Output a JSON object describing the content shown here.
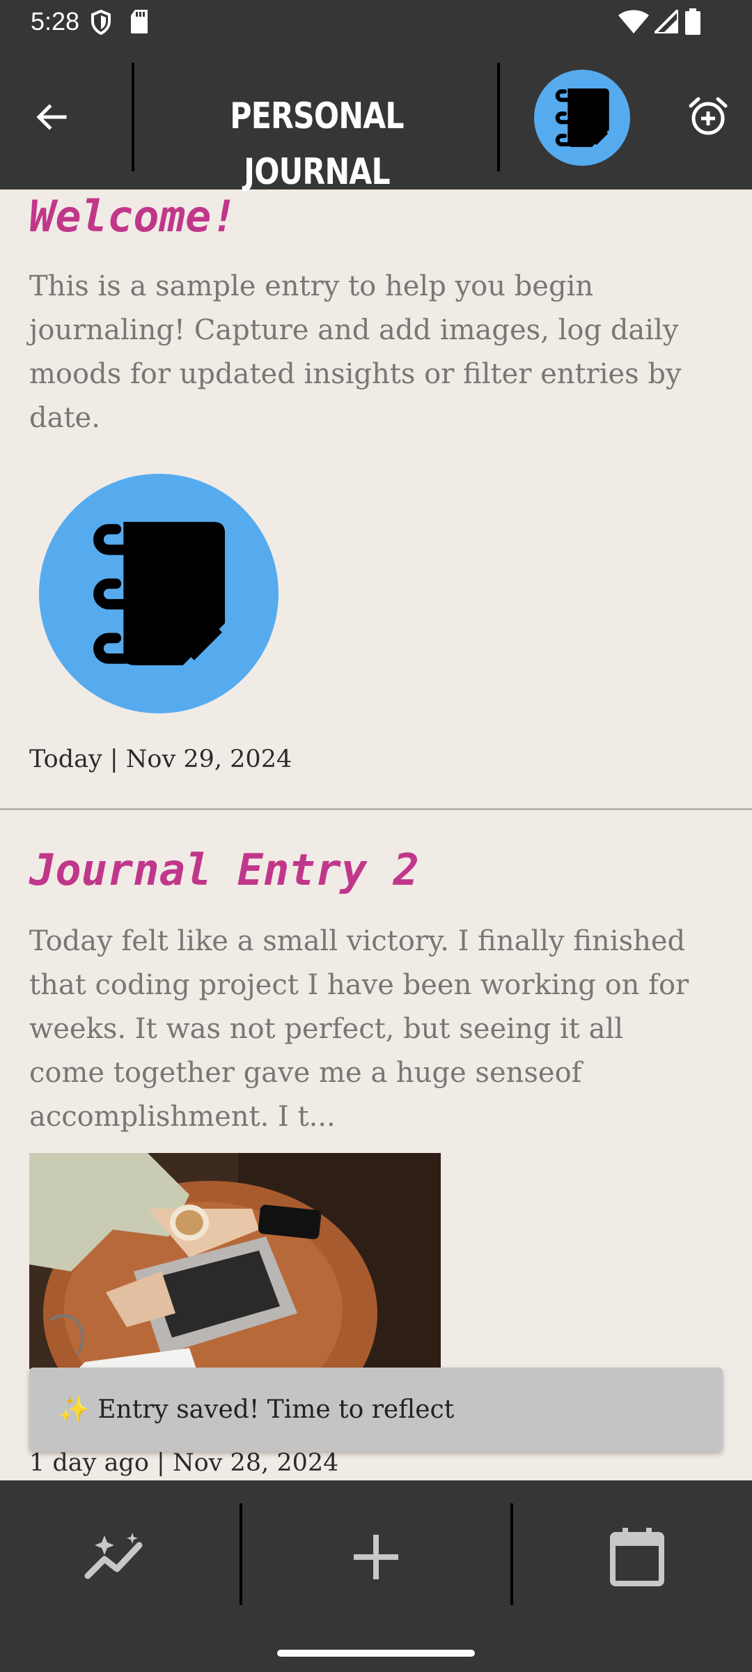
{
  "status_bar": {
    "time": "5:28"
  },
  "app_bar": {
    "title": "PERSONAL JOURNAL"
  },
  "entries": [
    {
      "title": "Welcome!",
      "body": "This is a sample entry to help you begin journaling! Capture and add images, log daily moods for updated insights or filter entries by date.",
      "date": "Today | Nov 29, 2024"
    },
    {
      "title": "Journal Entry 2",
      "body": "Today felt like a small victory. I finally finished that coding project I have been working on for weeks. It was not perfect, but seeing it all come together gave me a huge senseof accomplishment. I t...",
      "date": "1 day ago | Nov 28, 2024"
    }
  ],
  "snackbar": {
    "message": "✨ Entry saved! Time to reflect"
  },
  "colors": {
    "bar": "#363636",
    "accent": "#56ABEF",
    "title": "#C0378A",
    "background": "#F1EBE6"
  },
  "icons": [
    "back-arrow-icon",
    "journal-logo-icon",
    "add-alarm-icon",
    "insights-icon",
    "add-icon",
    "calendar-icon"
  ]
}
